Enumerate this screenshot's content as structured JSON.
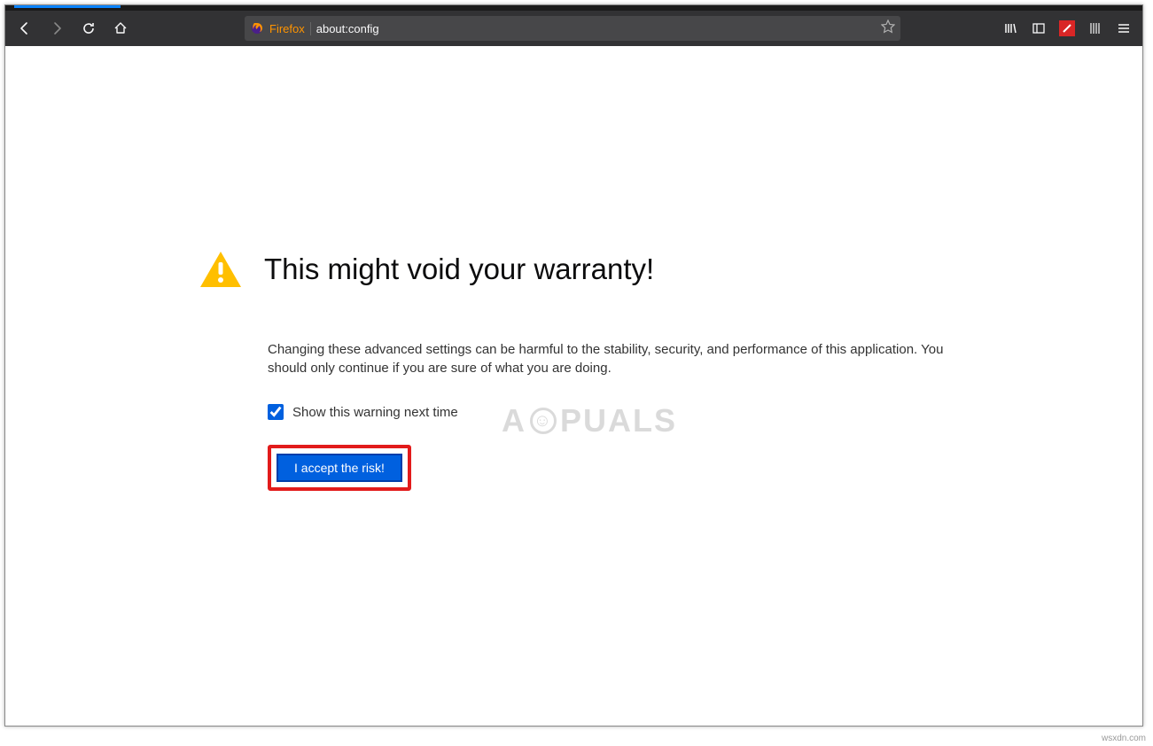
{
  "urlbar": {
    "identity_label": "Firefox",
    "url": "about:config"
  },
  "page": {
    "heading": "This might void your warranty!",
    "description": "Changing these advanced settings can be harmful to the stability, security, and performance of this application. You should only continue if you are sure of what you are doing.",
    "checkbox_label": "Show this warning next time",
    "checkbox_checked": true,
    "accept_button": "I accept the risk!"
  },
  "watermark": {
    "text_left": "A",
    "text_right": "PUALS"
  },
  "footer": {
    "credit": "wsxdn.com"
  }
}
